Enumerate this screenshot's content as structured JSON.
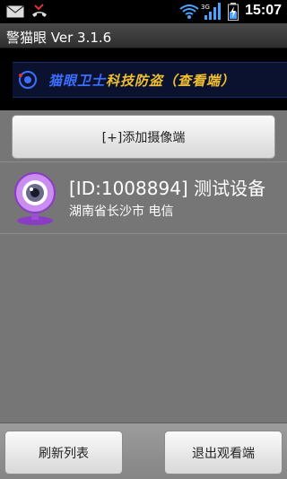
{
  "status_bar": {
    "time": "15:07",
    "network": "3G",
    "icons": [
      "mail-icon",
      "missed-call-icon",
      "wifi-icon",
      "signal-icon",
      "battery-charging-icon"
    ]
  },
  "app": {
    "title": "警猫眼 Ver 3.1.6"
  },
  "banner": {
    "brand_part1": "猫眼卫士",
    "brand_part2": "科技防盗",
    "tag": "（查看端）"
  },
  "actions": {
    "add_camera_label": "[+]添加摄像端"
  },
  "devices": [
    {
      "name": "[ID:1008894] 测试设备",
      "location": "湖南省长沙市 电信",
      "icon": "webcam-icon"
    }
  ],
  "bottom_bar": {
    "refresh_label": "刷新列表",
    "exit_label": "退出观看端"
  },
  "colors": {
    "content_bg": "#767676",
    "banner_gold": "#f0c030",
    "banner_blue": "#3c6fff",
    "webcam_purple": "#b068e0"
  }
}
